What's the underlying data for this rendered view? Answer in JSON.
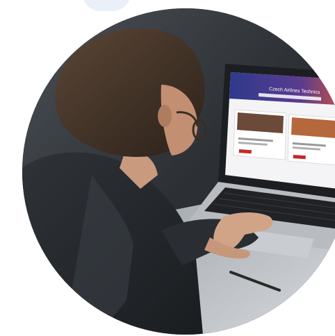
{
  "image": {
    "kind": "circular photo",
    "subject": "person-using-laptop"
  },
  "laptop_screen": {
    "page_title": "Czech Airlines Technics",
    "cards": [
      {
        "thumbnail": "building-photo"
      },
      {
        "thumbnail": "hangar-photo"
      }
    ]
  },
  "colors": {
    "deco_arc": "#e9f0f7",
    "screen_header": "#3b3f8f",
    "accent_red": "#c62828"
  }
}
